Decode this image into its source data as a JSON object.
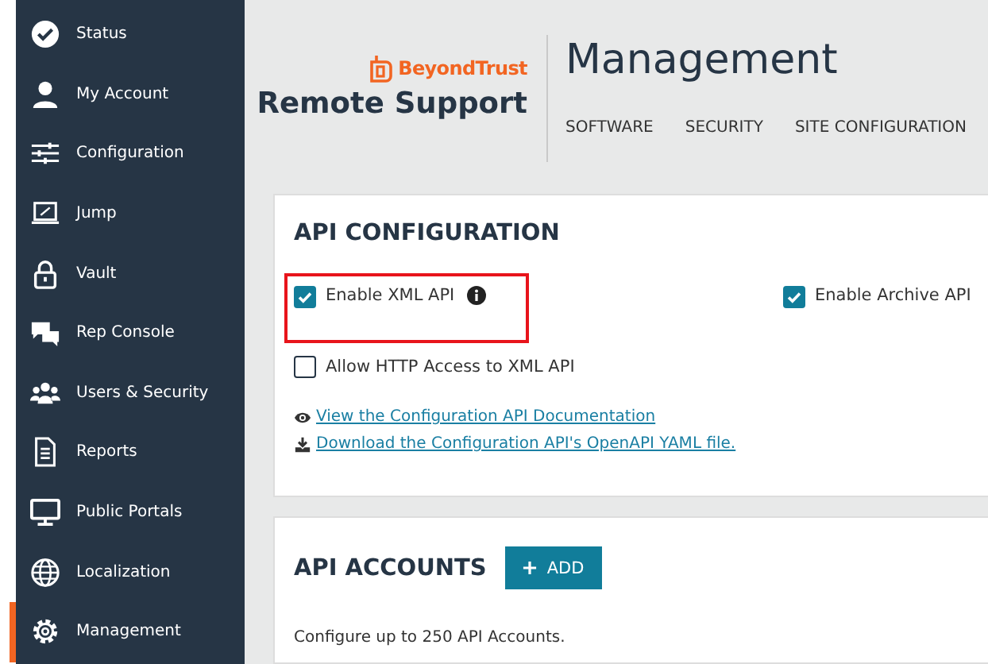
{
  "sidebar": {
    "items": [
      {
        "label": "Status",
        "selected": false
      },
      {
        "label": "My Account",
        "selected": false
      },
      {
        "label": "Configuration",
        "selected": false
      },
      {
        "label": "Jump",
        "selected": false
      },
      {
        "label": "Vault",
        "selected": false
      },
      {
        "label": "Rep Console",
        "selected": false
      },
      {
        "label": "Users & Security",
        "selected": false
      },
      {
        "label": "Reports",
        "selected": false
      },
      {
        "label": "Public Portals",
        "selected": false
      },
      {
        "label": "Localization",
        "selected": false
      },
      {
        "label": "Management",
        "selected": true
      }
    ]
  },
  "header": {
    "brand": "BeyondTrust",
    "product": "Remote Support",
    "title": "Management",
    "nav": [
      {
        "label": "SOFTWARE",
        "selected": false
      },
      {
        "label": "SECURITY",
        "selected": false
      },
      {
        "label": "SITE CONFIGURATION",
        "selected": false
      }
    ]
  },
  "api_configuration": {
    "heading": "API CONFIGURATION",
    "options": [
      {
        "label": "Enable XML API",
        "checked": true,
        "info": true,
        "highlighted": true
      },
      {
        "label": "Enable Archive API",
        "checked": true,
        "info": false,
        "highlighted": false
      },
      {
        "label": "Allow HTTP Access to XML API",
        "checked": false,
        "info": false,
        "highlighted": false
      }
    ],
    "links": [
      {
        "label": "View the Configuration API Documentation"
      },
      {
        "label": "Download the Configuration API's OpenAPI YAML file."
      }
    ]
  },
  "api_accounts": {
    "heading": "API ACCOUNTS",
    "add_button": "ADD",
    "note": "Configure up to 250 API Accounts."
  }
}
